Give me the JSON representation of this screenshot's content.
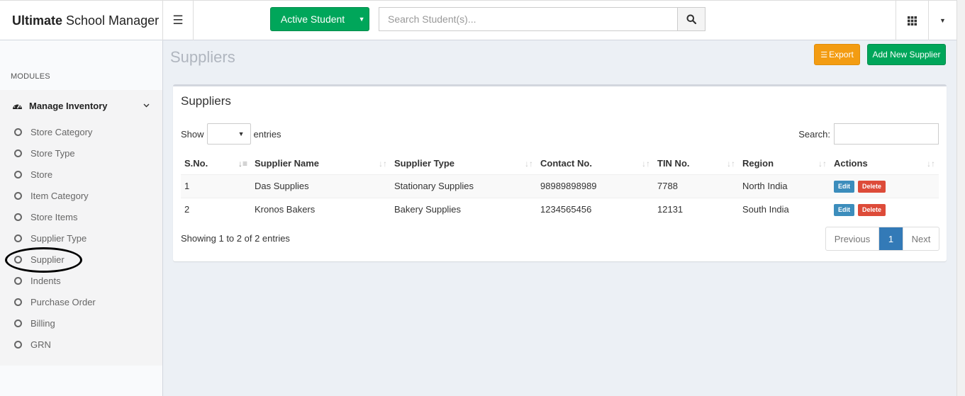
{
  "header": {
    "brand_bold": "Ultimate",
    "brand_rest": "School Manager",
    "active_button": "Active Student",
    "search_placeholder": "Search Student(s)..."
  },
  "sidebar": {
    "modules_label": "MODULES",
    "section": "Manage Inventory",
    "items": [
      "Store Category",
      "Store Type",
      "Store",
      "Item Category",
      "Store Items",
      "Supplier Type",
      "Supplier",
      "Indents",
      "Purchase Order",
      "Billing",
      "GRN"
    ]
  },
  "page": {
    "title": "Suppliers",
    "export_label": "Export",
    "add_label": "Add New Supplier"
  },
  "box": {
    "title": "Suppliers",
    "show_label": "Show",
    "entries_label": "entries",
    "search_label": "Search:",
    "info": "Showing 1 to 2 of 2 entries",
    "pagination": {
      "previous": "Previous",
      "page": "1",
      "next": "Next"
    }
  },
  "table": {
    "headers": [
      "S.No.",
      "Supplier Name",
      "Supplier Type",
      "Contact No.",
      "TIN No.",
      "Region",
      "Actions"
    ],
    "rows": [
      [
        "1",
        "Das Supplies",
        "Stationary Supplies",
        "98989898989",
        "7788",
        "North India"
      ],
      [
        "2",
        "Kronos Bakers",
        "Bakery Supplies",
        "1234565456",
        "12131",
        "South India"
      ]
    ],
    "edit_label": "Edit",
    "delete_label": "Delete"
  },
  "colors": {
    "green": "#00a65a",
    "orange": "#f39c12",
    "blue": "#3c8dbc",
    "red": "#dd4b39",
    "page_active": "#337ab7"
  }
}
